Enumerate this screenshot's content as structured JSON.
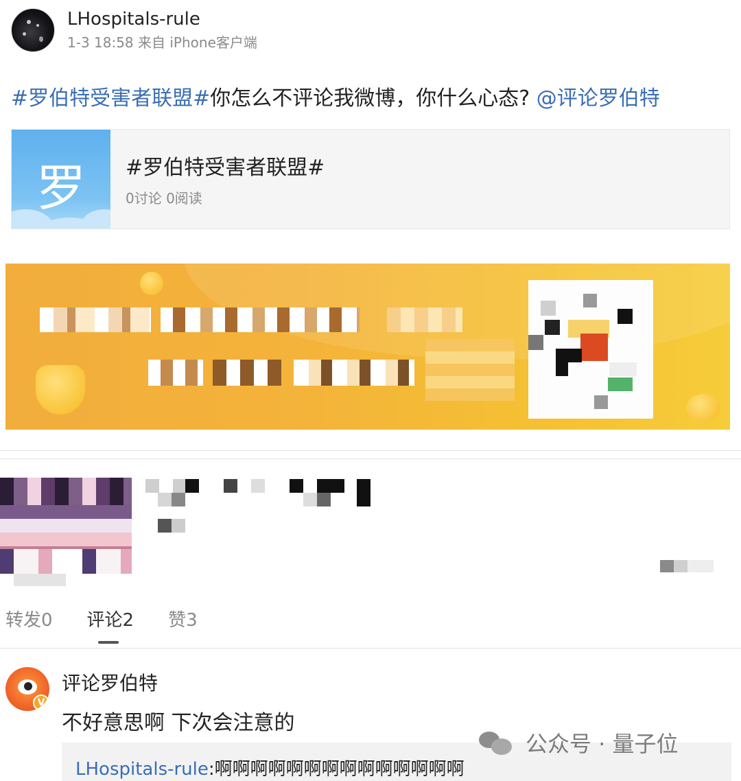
{
  "post": {
    "author_name": "LHospitals-rule",
    "time_source": "1-3 18:58 来自 iPhone客户端",
    "text_hashtag": "#罗伯特受害者联盟#",
    "text_body": "你怎么不评论我微博，你什么心态?",
    "text_mention": "@评论罗伯特"
  },
  "topic_card": {
    "thumb_char": "罗",
    "title": "#罗伯特受害者联盟#",
    "stats": "0讨论 0阅读"
  },
  "tabs": {
    "repost": "转发0",
    "comment": "评论2",
    "like": "赞3"
  },
  "comment": {
    "author_name": "评论罗伯特",
    "text": "不好意思啊 下次会注意的",
    "reply_author": "LHospitals-rule",
    "reply_text": ":啊啊啊啊啊啊啊啊啊啊啊啊啊啊"
  },
  "watermark": {
    "text": "公众号 · 量子位"
  }
}
